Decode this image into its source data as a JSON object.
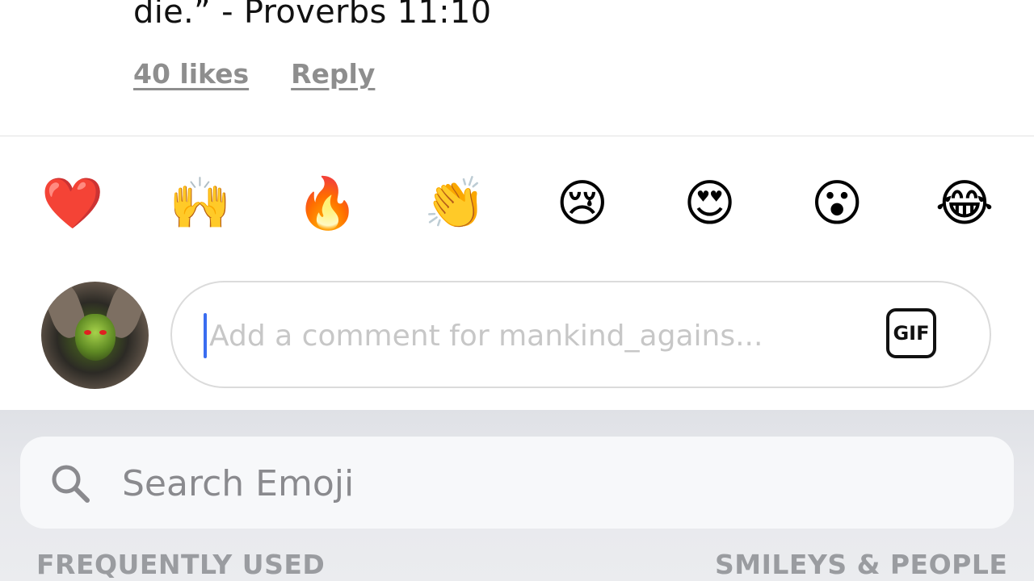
{
  "comment": {
    "text": "die.” - Proverbs 11:10",
    "likes": "40 likes",
    "reply": "Reply"
  },
  "reactions": [
    {
      "emoji": "❤️",
      "name": "red-heart"
    },
    {
      "emoji": "🙌",
      "name": "raising-hands"
    },
    {
      "emoji": "🔥",
      "name": "fire"
    },
    {
      "emoji": "👏",
      "name": "clapping-hands"
    },
    {
      "emoji": "😢",
      "name": "crying-face"
    },
    {
      "emoji": "😍",
      "name": "heart-eyes"
    },
    {
      "emoji": "😮",
      "name": "face-open-mouth"
    },
    {
      "emoji": "😂",
      "name": "tears-of-joy"
    }
  ],
  "composer": {
    "placeholder": "Add a comment for mankind_agains...",
    "gif_label": "GIF",
    "avatar_icon": "user-avatar"
  },
  "keyboard": {
    "search_placeholder": "Search Emoji",
    "category_frequent": "FREQUENTLY USED",
    "category_smileys": "SMILEYS & PEOPLE"
  },
  "colors": {
    "muted_text": "#8e8e8e",
    "caret": "#3a6df0",
    "keyboard_bg": "#e7e8ec"
  }
}
